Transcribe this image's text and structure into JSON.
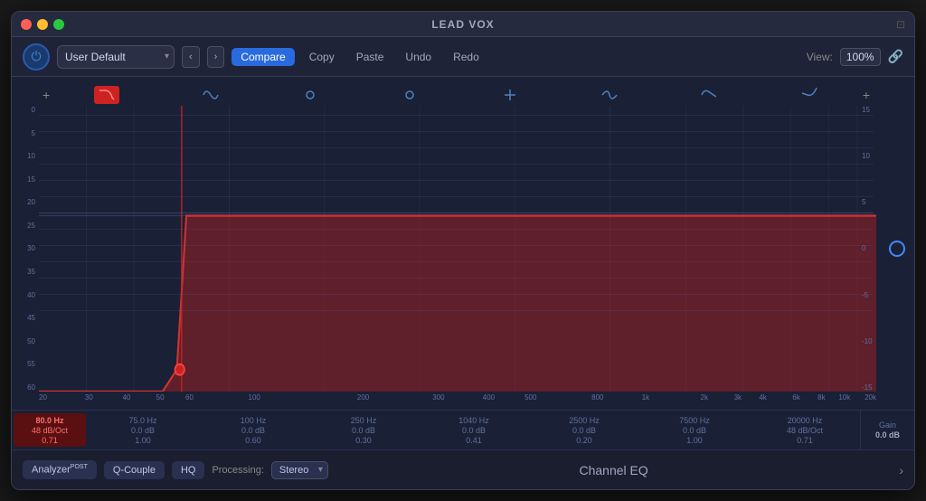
{
  "window": {
    "title": "LEAD VOX"
  },
  "toolbar": {
    "preset": "User Default",
    "compare_label": "Compare",
    "copy_label": "Copy",
    "paste_label": "Paste",
    "undo_label": "Undo",
    "redo_label": "Redo",
    "view_label": "View:",
    "view_value": "100%"
  },
  "eq": {
    "db_scale_left": [
      "0",
      "5",
      "10",
      "15",
      "20",
      "25",
      "30",
      "35",
      "40",
      "45",
      "50",
      "55",
      "60"
    ],
    "db_scale_right": [
      "15",
      "10",
      "5",
      "0",
      "-5",
      "-10",
      "-15"
    ],
    "freq_labels": [
      {
        "label": "20",
        "pct": 0
      },
      {
        "label": "30",
        "pct": 6
      },
      {
        "label": "40",
        "pct": 11
      },
      {
        "label": "50",
        "pct": 15
      },
      {
        "label": "60",
        "pct": 18
      },
      {
        "label": "100",
        "pct": 26
      },
      {
        "label": "200",
        "pct": 40
      },
      {
        "label": "300",
        "pct": 49
      },
      {
        "label": "400",
        "pct": 55
      },
      {
        "label": "500",
        "pct": 60
      },
      {
        "label": "800",
        "pct": 68
      },
      {
        "label": "1k",
        "pct": 74
      },
      {
        "label": "2k",
        "pct": 81
      },
      {
        "label": "3k",
        "pct": 85
      },
      {
        "label": "4k",
        "pct": 88
      },
      {
        "label": "6k",
        "pct": 92
      },
      {
        "label": "8k",
        "pct": 95
      },
      {
        "label": "10k",
        "pct": 97
      },
      {
        "label": "20k",
        "pct": 100
      }
    ],
    "bands": [
      {
        "freq": "80.0 Hz",
        "gain": "48 dB/Oct",
        "q": "0.71",
        "active": true
      },
      {
        "freq": "75.0 Hz",
        "gain": "0.0 dB",
        "q": "1.00",
        "active": false
      },
      {
        "freq": "100 Hz",
        "gain": "0.0 dB",
        "q": "0.60",
        "active": false
      },
      {
        "freq": "250 Hz",
        "gain": "0.0 dB",
        "q": "0.30",
        "active": false
      },
      {
        "freq": "1040 Hz",
        "gain": "0.0 dB",
        "q": "0.41",
        "active": false
      },
      {
        "freq": "2500 Hz",
        "gain": "0.0 dB",
        "q": "0.20",
        "active": false
      },
      {
        "freq": "7500 Hz",
        "gain": "0.0 dB",
        "q": "1.00",
        "active": false
      },
      {
        "freq": "20000 Hz",
        "gain": "48 dB/Oct",
        "q": "0.71",
        "active": false
      }
    ],
    "gain_label": "Gain",
    "gain_value": "0.0 dB"
  },
  "bottom_bar": {
    "analyzer_label": "Analyzer",
    "analyzer_post": "POST",
    "q_couple_label": "Q-Couple",
    "hq_label": "HQ",
    "processing_label": "Processing:",
    "processing_value": "Stereo",
    "channel_eq_label": "Channel EQ"
  }
}
